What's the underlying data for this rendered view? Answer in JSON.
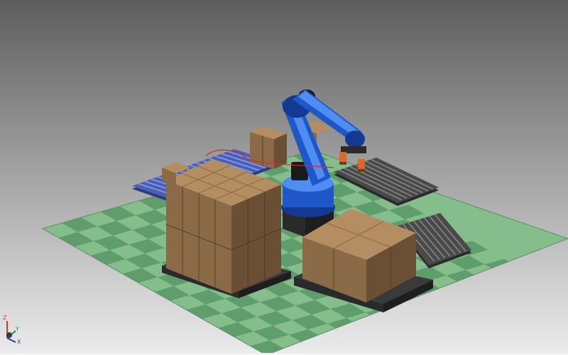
{
  "viewport": {
    "background_top": "#5d5d5d",
    "background_bottom": "#ececec"
  },
  "scene": {
    "floor": {
      "colors": [
        "#5f9e6c",
        "#86bd8d"
      ]
    },
    "robot": {
      "color": "#1f57c9",
      "highlight": "#4f8ef0",
      "shadow": "#123a92"
    },
    "boxes": {
      "front": "#8b6a47",
      "side": "#6b4f35",
      "top": "#b48d62"
    },
    "conveyors": {
      "frame": "#2e2e2e",
      "rollers": "#6e6e6e",
      "infeed": "#3d53a8"
    },
    "gripper": {
      "color": "#d9682b"
    }
  },
  "axis_triad": {
    "x_label": "X",
    "y_label": "Y",
    "z_label": "Z",
    "x_color": "#1f3fbf",
    "y_color": "#2a8f3a",
    "z_color": "#d03a2a"
  }
}
